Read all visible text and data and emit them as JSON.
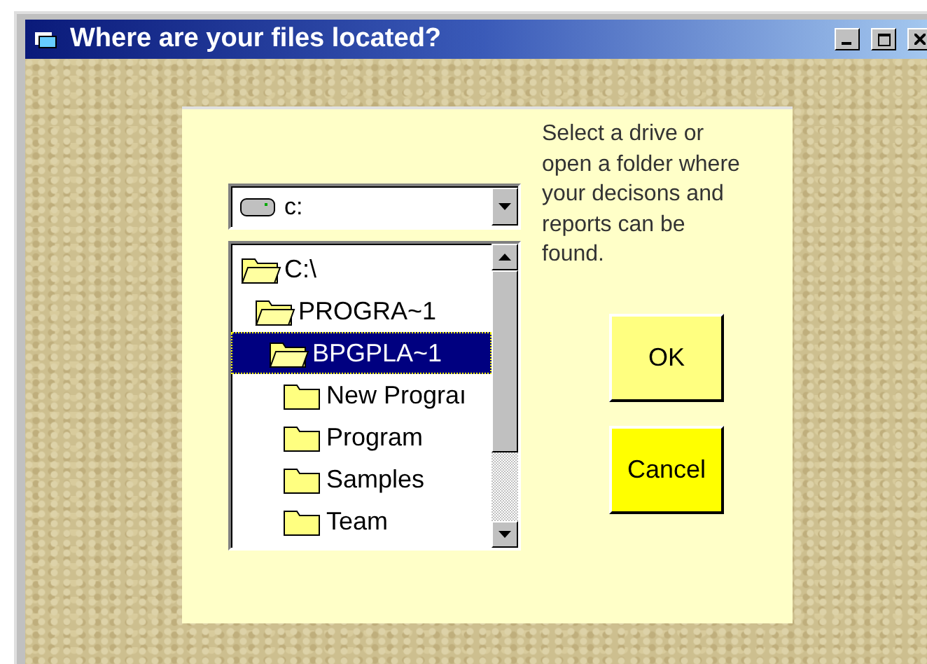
{
  "window": {
    "title": "Where are your files located?"
  },
  "drive": {
    "value": "c:"
  },
  "tree": [
    {
      "label": "C:\\",
      "expanded": true,
      "selected": false,
      "children": [
        {
          "label": "PROGRA~1",
          "expanded": true,
          "selected": false,
          "children": [
            {
              "label": "BPGPLA~1",
              "expanded": true,
              "selected": true,
              "children": [
                {
                  "label": "New Prograı",
                  "expanded": false,
                  "selected": false
                },
                {
                  "label": "Program",
                  "expanded": false,
                  "selected": false
                },
                {
                  "label": "Samples",
                  "expanded": false,
                  "selected": false
                },
                {
                  "label": "Team",
                  "expanded": false,
                  "selected": false
                }
              ]
            }
          ]
        }
      ]
    }
  ],
  "instructions": "Select a drive or open a folder where your decisons and reports can be found.",
  "buttons": [
    {
      "label": "OK",
      "kind": "ok"
    },
    {
      "label": "Cancel",
      "kind": "cancel"
    }
  ]
}
